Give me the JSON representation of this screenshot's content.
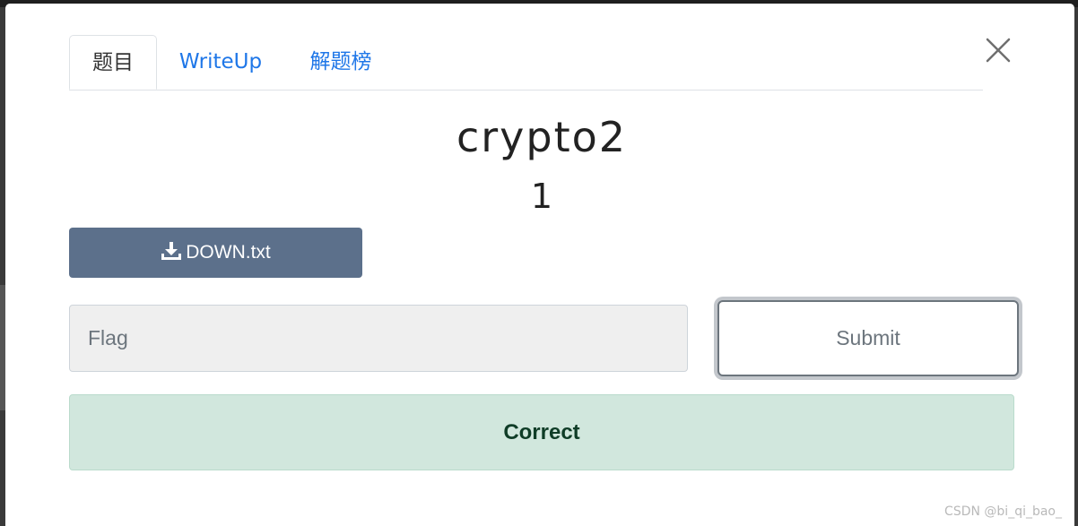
{
  "tabs": [
    {
      "label": "题目",
      "active": true
    },
    {
      "label": "WriteUp",
      "active": false
    },
    {
      "label": "解题榜",
      "active": false
    }
  ],
  "challenge": {
    "title": "crypto2",
    "value": "1"
  },
  "download": {
    "label": "DOWN.txt",
    "icon": "download-icon"
  },
  "flag_input": {
    "placeholder": "Flag",
    "value": ""
  },
  "submit": {
    "label": "Submit"
  },
  "alert": {
    "text": "Correct"
  },
  "close": {
    "icon": "close-icon"
  },
  "watermark": {
    "text": "CSDN @bi_qi_bao_"
  },
  "colors": {
    "tab_link": "#1f77e8",
    "download_bg": "#5c708b",
    "alert_bg": "#d1e7dd",
    "alert_text": "#0f3d27",
    "submit_border": "#6c757d"
  }
}
